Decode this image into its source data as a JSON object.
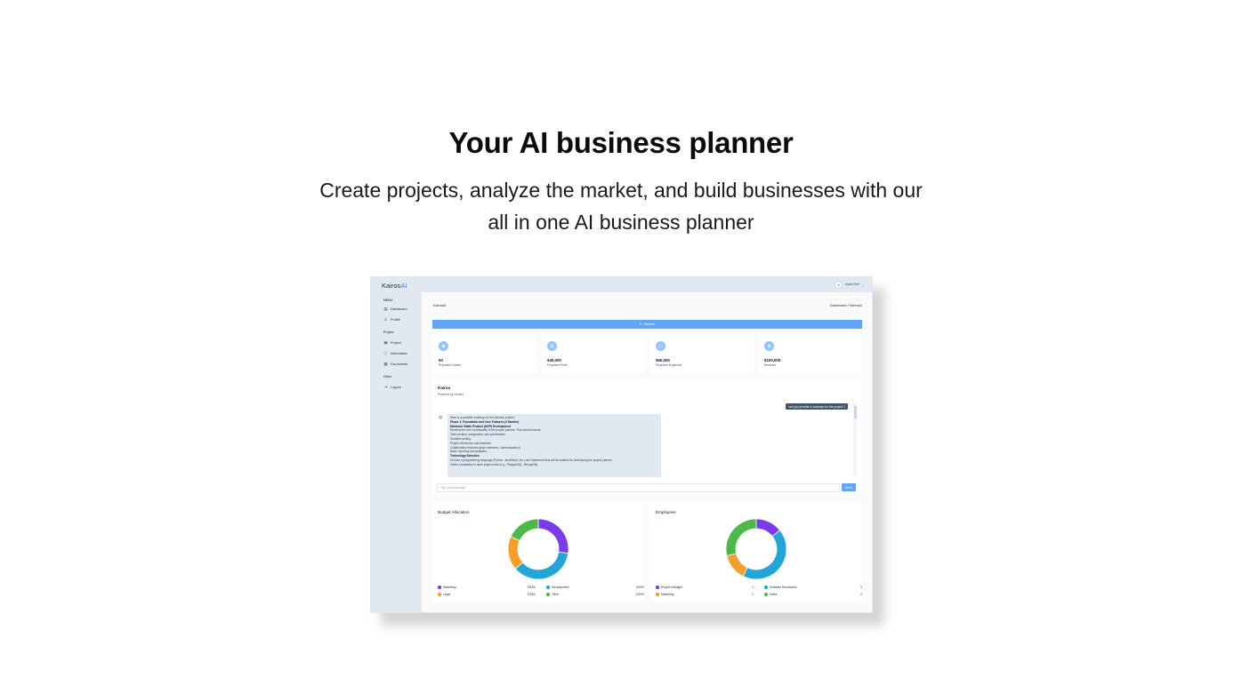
{
  "hero": {
    "title": "Your AI business planner",
    "subtitle_line1": "Create projects, analyze the market, and build businesses with our",
    "subtitle_line2": "all in one AI business planner"
  },
  "app": {
    "logo_main": "Kairos",
    "logo_ai": "AI",
    "user": {
      "name": "Kyan Dell",
      "avatar_icon": "user-avatar-icon"
    },
    "sidebar": {
      "sections": [
        {
          "label": "MENU",
          "items": [
            {
              "label": "Dashboard",
              "icon": "dashboard-icon"
            },
            {
              "label": "Profile",
              "icon": "user-icon"
            }
          ]
        },
        {
          "label": "Project",
          "items": [
            {
              "label": "Project",
              "icon": "project-icon"
            },
            {
              "label": "Information",
              "icon": "info-icon"
            },
            {
              "label": "Documents",
              "icon": "documents-icon"
            }
          ]
        },
        {
          "label": "Other",
          "items": [
            {
              "label": "Logout",
              "icon": "logout-icon"
            }
          ]
        }
      ]
    },
    "page": {
      "title": "KairosAI",
      "breadcrumb": "Dashboard / KairosAI",
      "refresh_label": "Refresh"
    },
    "stats": [
      {
        "value": "50",
        "label": "Projected Clients",
        "icon": "eye-icon"
      },
      {
        "value": "$40,000",
        "label": "Projected Profit",
        "icon": "cart-icon"
      },
      {
        "value": "$60,000",
        "label": "Projected Expenses",
        "icon": "bag-icon"
      },
      {
        "value": "$100,000",
        "label": "Revenue",
        "icon": "users-icon"
      }
    ],
    "chat": {
      "title": "Kairos",
      "powered_by": "Powered by Gemini",
      "user_message": "can you provide a roadmap for the project ?",
      "bot_lines": [
        {
          "text": "Here is a possible roadmap for the kairosAI project:",
          "bold": false
        },
        {
          "text": "Phase 1: Foundation and Core Features (3 Months)",
          "bold": true
        },
        {
          "text": "Minimum Viable Product (MVP) Development",
          "bold": true
        },
        {
          "text": "Develop the core functionality of the project planner. This should include:",
          "bold": false
        },
        {
          "text": "Task creation, assignment, and prioritization",
          "bold": false
        },
        {
          "text": "Deadline setting",
          "bold": false
        },
        {
          "text": "Project milestones and timelines",
          "bold": false
        },
        {
          "text": "Collaboration features (team members, communication)",
          "bold": false
        },
        {
          "text": "Basic reporting and analytics",
          "bold": false
        },
        {
          "text": "Technology Selection",
          "bold": true
        },
        {
          "text": "Choose a programming language (Python, JavaScript, etc.) and framework that will be suitable for developing the project planner.",
          "bold": false
        },
        {
          "text": "Select a database to store project data (e.g., PostgreSQL, MongoDB).",
          "bold": false
        }
      ],
      "input_placeholder": "Type your message...",
      "send_label": "Send"
    },
    "budget": {
      "title": "Budget Allocation",
      "chart_data": {
        "type": "pie",
        "categories": [
          "Marketing",
          "Development",
          "Legal",
          "Other"
        ],
        "values": [
          15000,
          20000,
          10000,
          10000
        ],
        "colors": [
          "#7c3aed",
          "#22a6d8",
          "#f59e2a",
          "#4cb847"
        ]
      }
    },
    "employees": {
      "title": "Employees",
      "chart_data": {
        "type": "pie",
        "categories": [
          "Project manager",
          "Software Developers",
          "Marketing",
          "Sales"
        ],
        "values": [
          1,
          3,
          1,
          2
        ],
        "colors": [
          "#7c3aed",
          "#22a6d8",
          "#f59e2a",
          "#4cb847"
        ]
      }
    }
  }
}
